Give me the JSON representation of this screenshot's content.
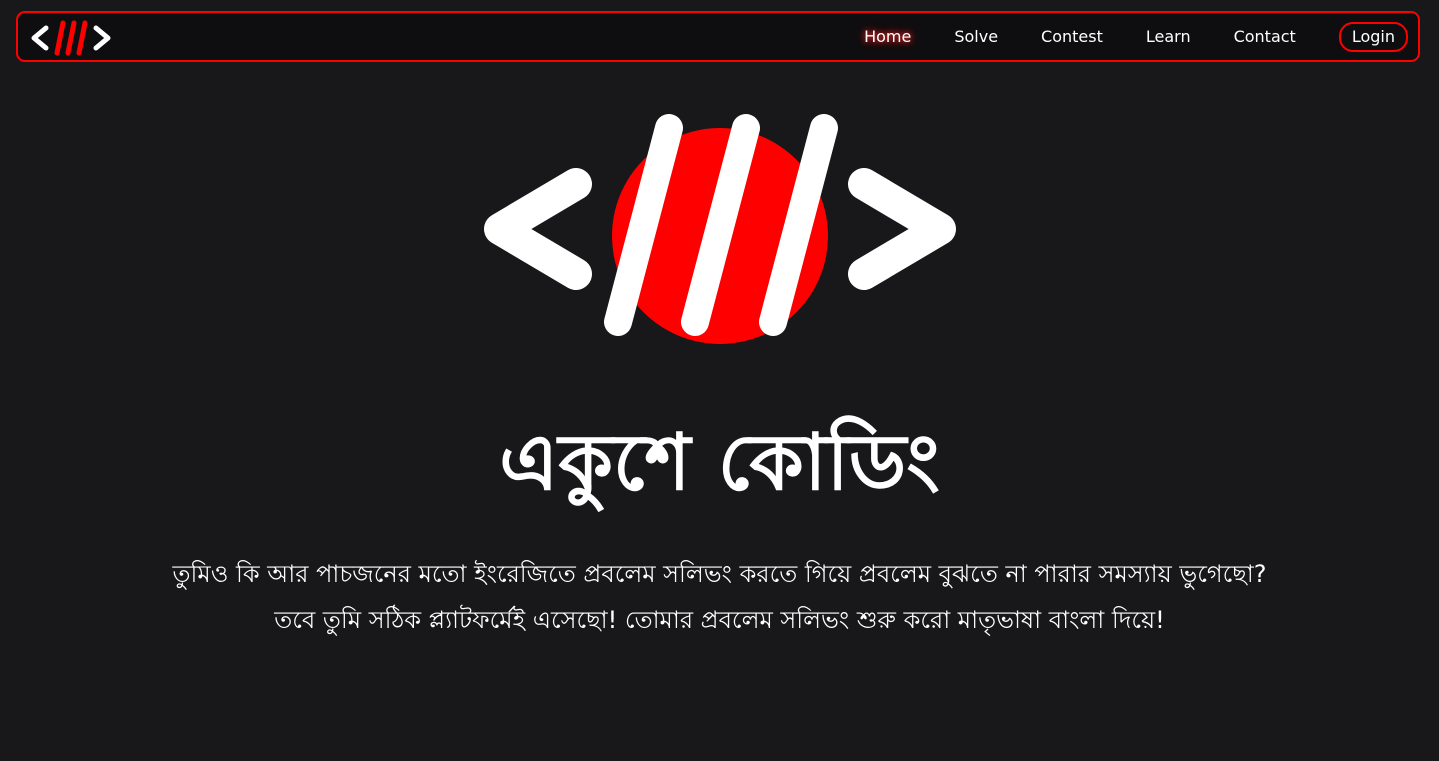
{
  "brand": {
    "logo_icon": "code-brackets-slashes-logo",
    "accent_color": "#ff0000",
    "background_color": "#18181b"
  },
  "nav": {
    "items": [
      {
        "label": "Home",
        "active": true
      },
      {
        "label": "Solve",
        "active": false
      },
      {
        "label": "Contest",
        "active": false
      },
      {
        "label": "Learn",
        "active": false
      },
      {
        "label": "Contact",
        "active": false
      }
    ],
    "login_label": "Login"
  },
  "hero": {
    "title": "একুশে কোডিং",
    "description_line1": "তুমিও কি আর পাচজনের মতো ইংরেজিতে প্রবলেম সলিভং করতে গিয়ে প্রবলেম বুঝতে না পারার সমস্যায় ভুগেছো?",
    "description_line2": "তবে তুমি সঠিক প্ল্যাটফর্মেই এসেছো! তোমার প্রবলেম সলিভং  শুরু করো মাতৃভাষা বাংলা দিয়ে!"
  }
}
